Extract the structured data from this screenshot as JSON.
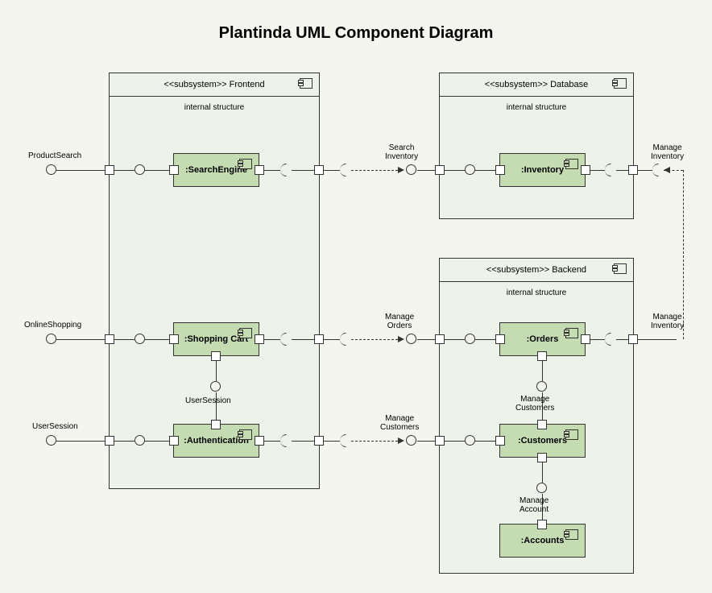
{
  "title": "Plantinda UML Component Diagram",
  "subsystems": {
    "frontend": {
      "stereotype": "<<subsystem>> Frontend",
      "internal": "internal structure"
    },
    "database": {
      "stereotype": "<<subsystem>> Database",
      "internal": "internal structure"
    },
    "backend": {
      "stereotype": "<<subsystem>> Backend",
      "internal": "internal structure"
    }
  },
  "components": {
    "searchEngine": ":SearchEngine",
    "shoppingCart": ":Shopping Cart",
    "authentication": ":Authentication",
    "inventory": ":Inventory",
    "orders": ":Orders",
    "customers": ":Customers",
    "accounts": ":Accounts"
  },
  "labels": {
    "productSearch": "ProductSearch",
    "onlineShopping": "OnlineShopping",
    "userSessionLeft": "UserSession",
    "userSessionInner": "UserSession",
    "searchInventory": "Search\nInventory",
    "manageInventoryTop": "Manage\nInventory",
    "manageInventoryRight": "Manage\nInventory",
    "manageOrders": "Manage\nOrders",
    "manageCustomers": "Manage\nCustomers",
    "manageCustomersInner": "Manage\nCustomers",
    "manageAccount": "Manage\nAccount"
  }
}
